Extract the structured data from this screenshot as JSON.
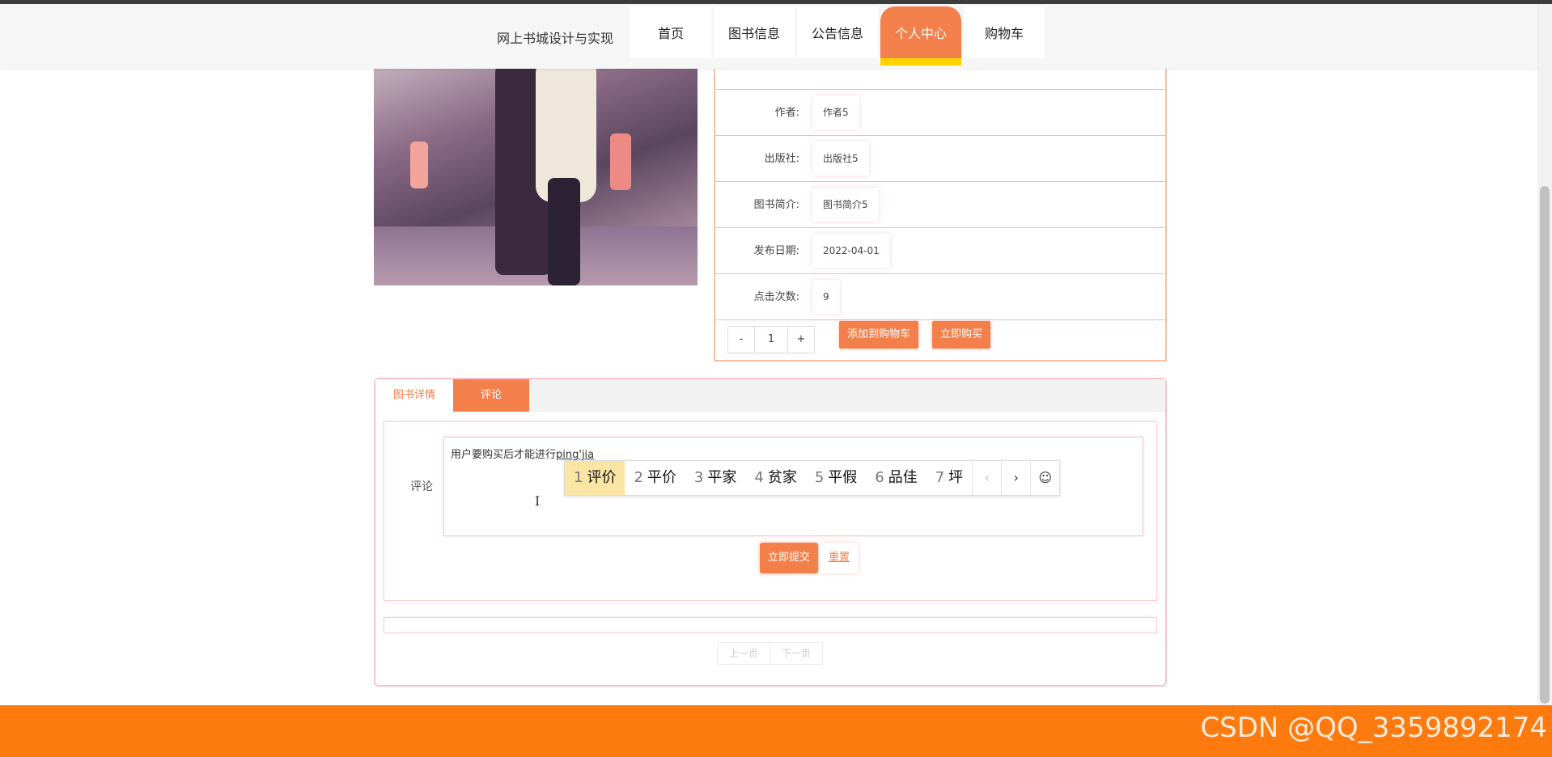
{
  "header": {
    "site_title": "网上书城设计与实现",
    "nav": [
      {
        "label": "首页"
      },
      {
        "label": "图书信息"
      },
      {
        "label": "公告信息"
      },
      {
        "label": "个人中心"
      },
      {
        "label": "购物车"
      }
    ]
  },
  "book": {
    "rows": [
      {
        "label": "作者:",
        "value": "作者5"
      },
      {
        "label": "出版社:",
        "value": "出版社5"
      },
      {
        "label": "图书简介:",
        "value": "图书简介5"
      },
      {
        "label": "发布日期:",
        "value": "2022-04-01"
      },
      {
        "label": "点击次数:",
        "value": "9"
      }
    ],
    "quantity": "1",
    "minus": "-",
    "plus": "+",
    "add_to_cart": "添加到购物车",
    "buy_now": "立即购买"
  },
  "tabs": [
    {
      "label": "图书详情"
    },
    {
      "label": "评论"
    }
  ],
  "comment_form": {
    "label": "评论",
    "text_prefix": "用户要购买后才能进行",
    "typed_pinyin": "ping'jia",
    "submit": "立即提交",
    "reset": "重置"
  },
  "pager": {
    "prev": "上一页",
    "next": "下一页"
  },
  "ime": {
    "candidates": [
      {
        "num": "1",
        "text": "评价"
      },
      {
        "num": "2",
        "text": "平价"
      },
      {
        "num": "3",
        "text": "平家"
      },
      {
        "num": "4",
        "text": "贫家"
      },
      {
        "num": "5",
        "text": "平假"
      },
      {
        "num": "6",
        "text": "品佳"
      },
      {
        "num": "7",
        "text": "坪"
      }
    ],
    "prev": "‹",
    "next": "›",
    "emoji": "☺"
  },
  "watermark": "CSDN @QQ_3359892174",
  "colors": {
    "accent": "#f3804b",
    "footer": "#fd7b0e",
    "highlight": "#ffd200"
  }
}
